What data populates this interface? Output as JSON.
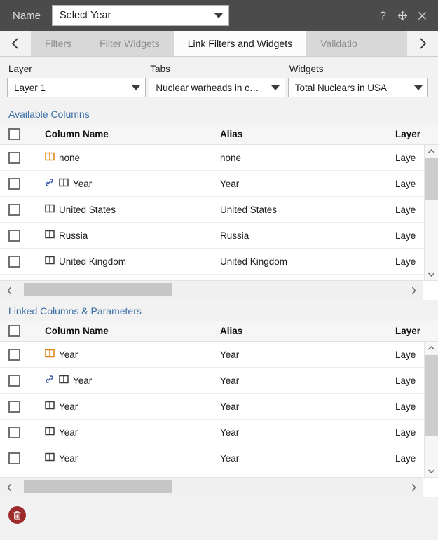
{
  "titlebar": {
    "name_label": "Name",
    "name_value": "Select Year",
    "name_placeholder": "Select Year",
    "help_icon": "question-mark-icon",
    "move_icon": "move-arrows-icon",
    "close_icon": "close-icon"
  },
  "tabs": {
    "prev_icon": "chevron-left-icon",
    "next_icon": "chevron-right-icon",
    "items": [
      {
        "label": "Filters",
        "active": false
      },
      {
        "label": "Filter Widgets",
        "active": false
      },
      {
        "label": "Link Filters and Widgets",
        "active": true
      },
      {
        "label": "Validatio",
        "active": false
      }
    ]
  },
  "selectors": {
    "layer": {
      "label": "Layer",
      "value": "Layer 1"
    },
    "tabs": {
      "label": "Tabs",
      "value": "Nuclear warheads in c…"
    },
    "widgets": {
      "label": "Widgets",
      "value": "Total Nuclears in USA"
    }
  },
  "available_columns": {
    "title": "Available Columns",
    "headers": {
      "column_name": "Column Name",
      "alias": "Alias",
      "layer": "Layer"
    },
    "rows": [
      {
        "name": "none",
        "alias": "none",
        "layer": "Laye",
        "icon": "column-icon",
        "icon_color": "#e08214",
        "linked": false
      },
      {
        "name": "Year",
        "alias": "Year",
        "layer": "Laye",
        "icon": "column-icon",
        "icon_color": "#3c3c3c",
        "linked": true
      },
      {
        "name": "United States",
        "alias": "United States",
        "layer": "Laye",
        "icon": "column-icon",
        "icon_color": "#3c3c3c",
        "linked": false
      },
      {
        "name": "Russia",
        "alias": "Russia",
        "layer": "Laye",
        "icon": "column-icon",
        "icon_color": "#3c3c3c",
        "linked": false
      },
      {
        "name": "United Kingdom",
        "alias": "United Kingdom",
        "layer": "Laye",
        "icon": "column-icon",
        "icon_color": "#3c3c3c",
        "linked": false
      }
    ]
  },
  "linked_columns": {
    "title": "Linked Columns & Parameters",
    "headers": {
      "column_name": "Column Name",
      "alias": "Alias",
      "layer": "Layer"
    },
    "rows": [
      {
        "name": "Year",
        "alias": "Year",
        "layer": "Laye",
        "icon": "column-icon",
        "icon_color": "#e08214",
        "linked": false
      },
      {
        "name": "Year",
        "alias": "Year",
        "layer": "Laye",
        "icon": "column-icon",
        "icon_color": "#3c3c3c",
        "linked": true
      },
      {
        "name": "Year",
        "alias": "Year",
        "layer": "Laye",
        "icon": "column-icon",
        "icon_color": "#3c3c3c",
        "linked": false
      },
      {
        "name": "Year",
        "alias": "Year",
        "layer": "Laye",
        "icon": "column-icon",
        "icon_color": "#3c3c3c",
        "linked": false
      },
      {
        "name": "Year",
        "alias": "Year",
        "layer": "Laye",
        "icon": "column-icon",
        "icon_color": "#3c3c3c",
        "linked": false
      }
    ]
  },
  "footer": {
    "delete_icon": "trash-icon"
  },
  "colors": {
    "titlebar_bg": "#4b4b4b",
    "tab_bg": "#d8d8d8",
    "tab_active_bg": "#fcfcfc",
    "section_title": "#3a6ea5",
    "link_icon": "#3b5bab",
    "column_icon_accent": "#e08214",
    "delete_button": "#9e2b2b"
  }
}
